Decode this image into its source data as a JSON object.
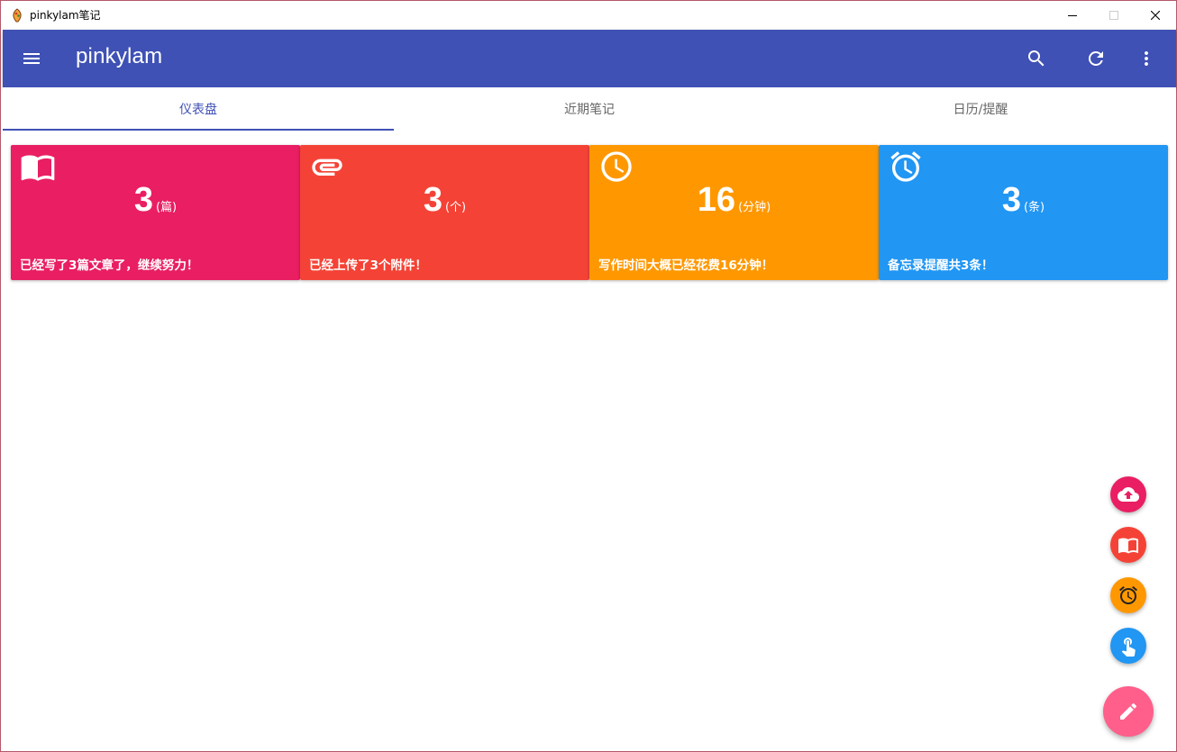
{
  "window": {
    "title": "pinkylam笔记",
    "icon": "app-logo-icon"
  },
  "appbar": {
    "title": "pinkylam",
    "color": "#3f51b5",
    "actions": [
      "search-icon",
      "refresh-icon",
      "more-vert-icon"
    ]
  },
  "tabs": [
    {
      "label": "仪表盘",
      "active": true
    },
    {
      "label": "近期笔记",
      "active": false
    },
    {
      "label": "日历/提醒",
      "active": false
    }
  ],
  "cards": [
    {
      "icon": "book-icon",
      "count": "3",
      "unit": "(篇)",
      "desc": "已经写了3篇文章了，继续努力！",
      "color": "#e91e63"
    },
    {
      "icon": "attachment-icon",
      "count": "3",
      "unit": "(个)",
      "desc": "已经上传了3个附件！",
      "color": "#f44336"
    },
    {
      "icon": "clock-icon",
      "count": "16",
      "unit": "(分钟)",
      "desc": "写作时间大概已经花费16分钟！",
      "color": "#ff9800"
    },
    {
      "icon": "alarm-icon",
      "count": "3",
      "unit": "(条)",
      "desc": "备忘录提醒共3条！",
      "color": "#2196f3"
    }
  ],
  "fabs": [
    {
      "icon": "cloud-upload-icon",
      "color": "#e91e63"
    },
    {
      "icon": "book-icon",
      "color": "#f44336"
    },
    {
      "icon": "alarm-icon",
      "color": "#ff9800"
    },
    {
      "icon": "touch-icon",
      "color": "#2196f3"
    }
  ],
  "main_fab": {
    "icon": "edit-icon",
    "color": "#ff5f8a"
  }
}
